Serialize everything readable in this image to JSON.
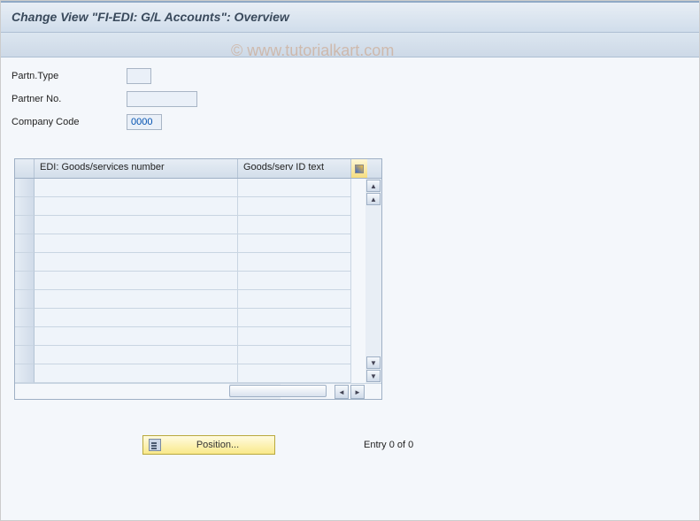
{
  "header": {
    "title": "Change View \"FI-EDI: G/L Accounts\": Overview"
  },
  "form": {
    "partn_type_label": "Partn.Type",
    "partn_type_value": "",
    "partner_no_label": "Partner No.",
    "partner_no_value": "",
    "company_code_label": "Company Code",
    "company_code_value": "0000"
  },
  "table": {
    "col1_header": "EDI: Goods/services number",
    "col2_header": "Goods/serv ID text",
    "rows": [
      {
        "c1": "",
        "c2": ""
      },
      {
        "c1": "",
        "c2": ""
      },
      {
        "c1": "",
        "c2": ""
      },
      {
        "c1": "",
        "c2": ""
      },
      {
        "c1": "",
        "c2": ""
      },
      {
        "c1": "",
        "c2": ""
      },
      {
        "c1": "",
        "c2": ""
      },
      {
        "c1": "",
        "c2": ""
      },
      {
        "c1": "",
        "c2": ""
      },
      {
        "c1": "",
        "c2": ""
      },
      {
        "c1": "",
        "c2": ""
      }
    ]
  },
  "footer": {
    "position_label": "Position...",
    "entry_text": "Entry 0 of 0"
  },
  "watermark": "© www.tutorialkart.com"
}
